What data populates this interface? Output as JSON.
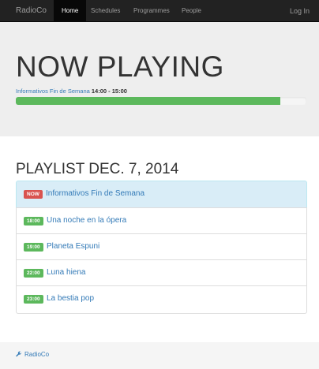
{
  "navbar": {
    "brand": "RadioCo",
    "items": [
      {
        "label": "Home",
        "active": true
      },
      {
        "label": "Schedules",
        "active": false
      },
      {
        "label": "Programmes",
        "active": false
      },
      {
        "label": "People",
        "active": false
      }
    ],
    "login_label": "Log In"
  },
  "hero": {
    "title": "NOW PLAYING",
    "programme": "Informativos Fin de Semana",
    "time": "14:00 - 15:00",
    "progress_percent": 91,
    "progress_color": "#5cb85c"
  },
  "playlist": {
    "title": "PLAYLIST DEC. 7, 2014",
    "items": [
      {
        "badge": "NOW",
        "badge_color": "#d9534f",
        "name": "Informativos Fin de Semana",
        "active": true
      },
      {
        "badge": "18:00",
        "badge_color": "#5cb85c",
        "name": "Una noche en la ópera",
        "active": false
      },
      {
        "badge": "19:00",
        "badge_color": "#5cb85c",
        "name": "Planeta Espuni",
        "active": false
      },
      {
        "badge": "22:00",
        "badge_color": "#5cb85c",
        "name": "Luna hiena",
        "active": false
      },
      {
        "badge": "23:00",
        "badge_color": "#5cb85c",
        "name": "La bestia pop",
        "active": false
      }
    ]
  },
  "footer": {
    "icon": "wrench-icon",
    "label": "RadioCo"
  }
}
